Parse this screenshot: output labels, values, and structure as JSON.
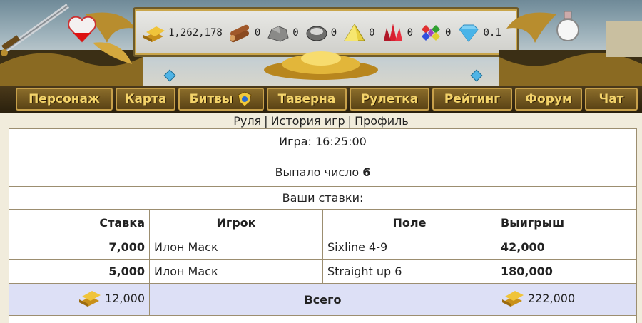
{
  "resources": [
    {
      "icon": "gold-bars-icon",
      "value": "1,262,178"
    },
    {
      "icon": "logs-icon",
      "value": "0"
    },
    {
      "icon": "stone-icon",
      "value": "0"
    },
    {
      "icon": "iron-ore-icon",
      "value": "0"
    },
    {
      "icon": "sulfur-icon",
      "value": "0"
    },
    {
      "icon": "red-crystal-icon",
      "value": "0"
    },
    {
      "icon": "gems-icon",
      "value": "0"
    },
    {
      "icon": "diamond-icon",
      "value": "0.1"
    }
  ],
  "nav": {
    "character": "Персонаж",
    "map": "Карта",
    "battles": "Битвы",
    "tavern": "Таверна",
    "roulette": "Рулетка",
    "rating": "Рейтинг",
    "forum": "Форум",
    "chat": "Чат"
  },
  "sublinks": {
    "roulette": "Руля",
    "history": "История игр",
    "profile": "Профиль",
    "separator": "|"
  },
  "game": {
    "time_label": "Игра: 16:25:00",
    "result_label": "Выпало число",
    "result_number": "6"
  },
  "bets": {
    "title": "Ваши ставки:",
    "headers": {
      "stake": "Ставка",
      "player": "Игрок",
      "field": "Поле",
      "win": "Выигрыш"
    },
    "rows": [
      {
        "stake": "7,000",
        "player": "Илон Маск",
        "field": "Sixline 4-9",
        "win": "42,000"
      },
      {
        "stake": "5,000",
        "player": "Илон Маск",
        "field": "Straight up 6",
        "win": "180,000"
      }
    ],
    "total": {
      "stake": "12,000",
      "label": "Всего",
      "win": "222,000"
    }
  },
  "colors": {
    "nav_text": "#f3d36a",
    "total_row": "#dde0f6",
    "border": "#9c8e70"
  }
}
